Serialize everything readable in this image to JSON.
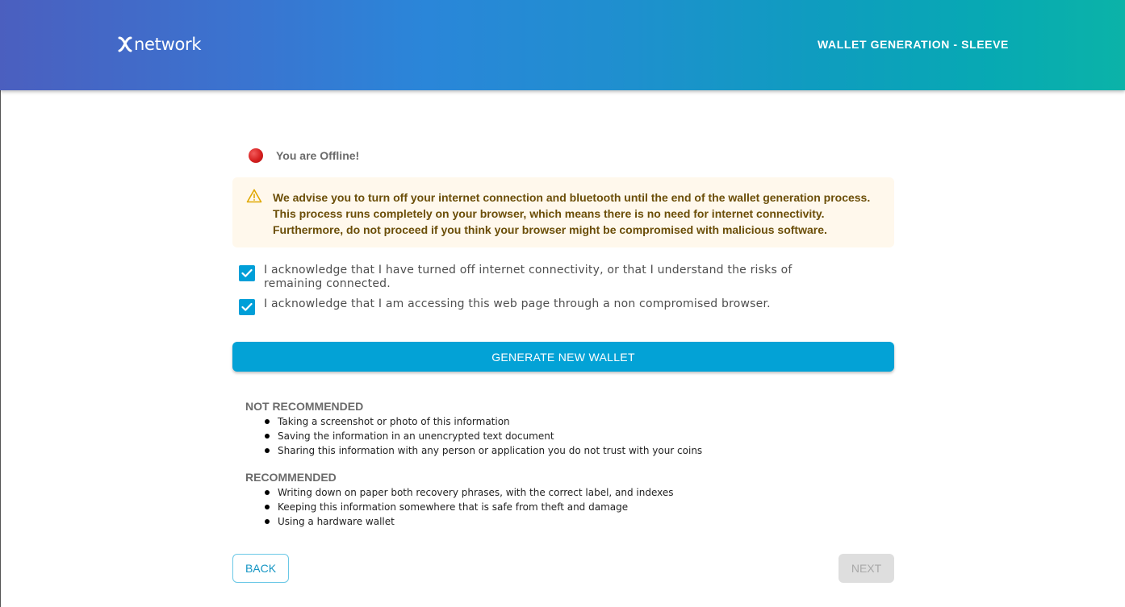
{
  "header": {
    "logo_text": "network",
    "title": "WALLET GENERATION - SLEEVE",
    "gradient_colors": [
      "#4b5fbf",
      "#2a86d9",
      "#0bb3a8"
    ]
  },
  "status": {
    "icon": "red-circle-icon",
    "color": "#d61f1f",
    "text": "You are Offline!"
  },
  "warning": {
    "icon": "warning-triangle-icon",
    "lines": [
      "We advise you to turn off your internet connection and bluetooth until the end of the wallet generation process.",
      "This process runs completely on your browser, which means there is no need for internet connectivity.",
      "Furthermore, do not proceed if you think your browser might be compromised with malicious software."
    ]
  },
  "acknowledgements": [
    {
      "checked": true,
      "text": "I acknowledge that I have turned off internet connectivity, or that I understand the risks of remaining connected."
    },
    {
      "checked": true,
      "text": "I acknowledge that I am accessing this web page through a non compromised browser."
    }
  ],
  "generate_button": {
    "label": "GENERATE NEW WALLET",
    "color": "#03a2d6"
  },
  "not_recommended": {
    "title": "NOT RECOMMENDED",
    "items": [
      "Taking a screenshot or photo of this information",
      "Saving the information in an unencrypted text document",
      "Sharing this information with any person or application you do not trust with your coins"
    ]
  },
  "recommended": {
    "title": "RECOMMENDED",
    "items": [
      "Writing down on paper both recovery phrases, with the correct label, and indexes",
      "Keeping this information somewhere that is safe from theft and damage",
      "Using a hardware wallet"
    ]
  },
  "footer": {
    "back_label": "BACK",
    "next_label": "NEXT",
    "next_disabled": true
  }
}
